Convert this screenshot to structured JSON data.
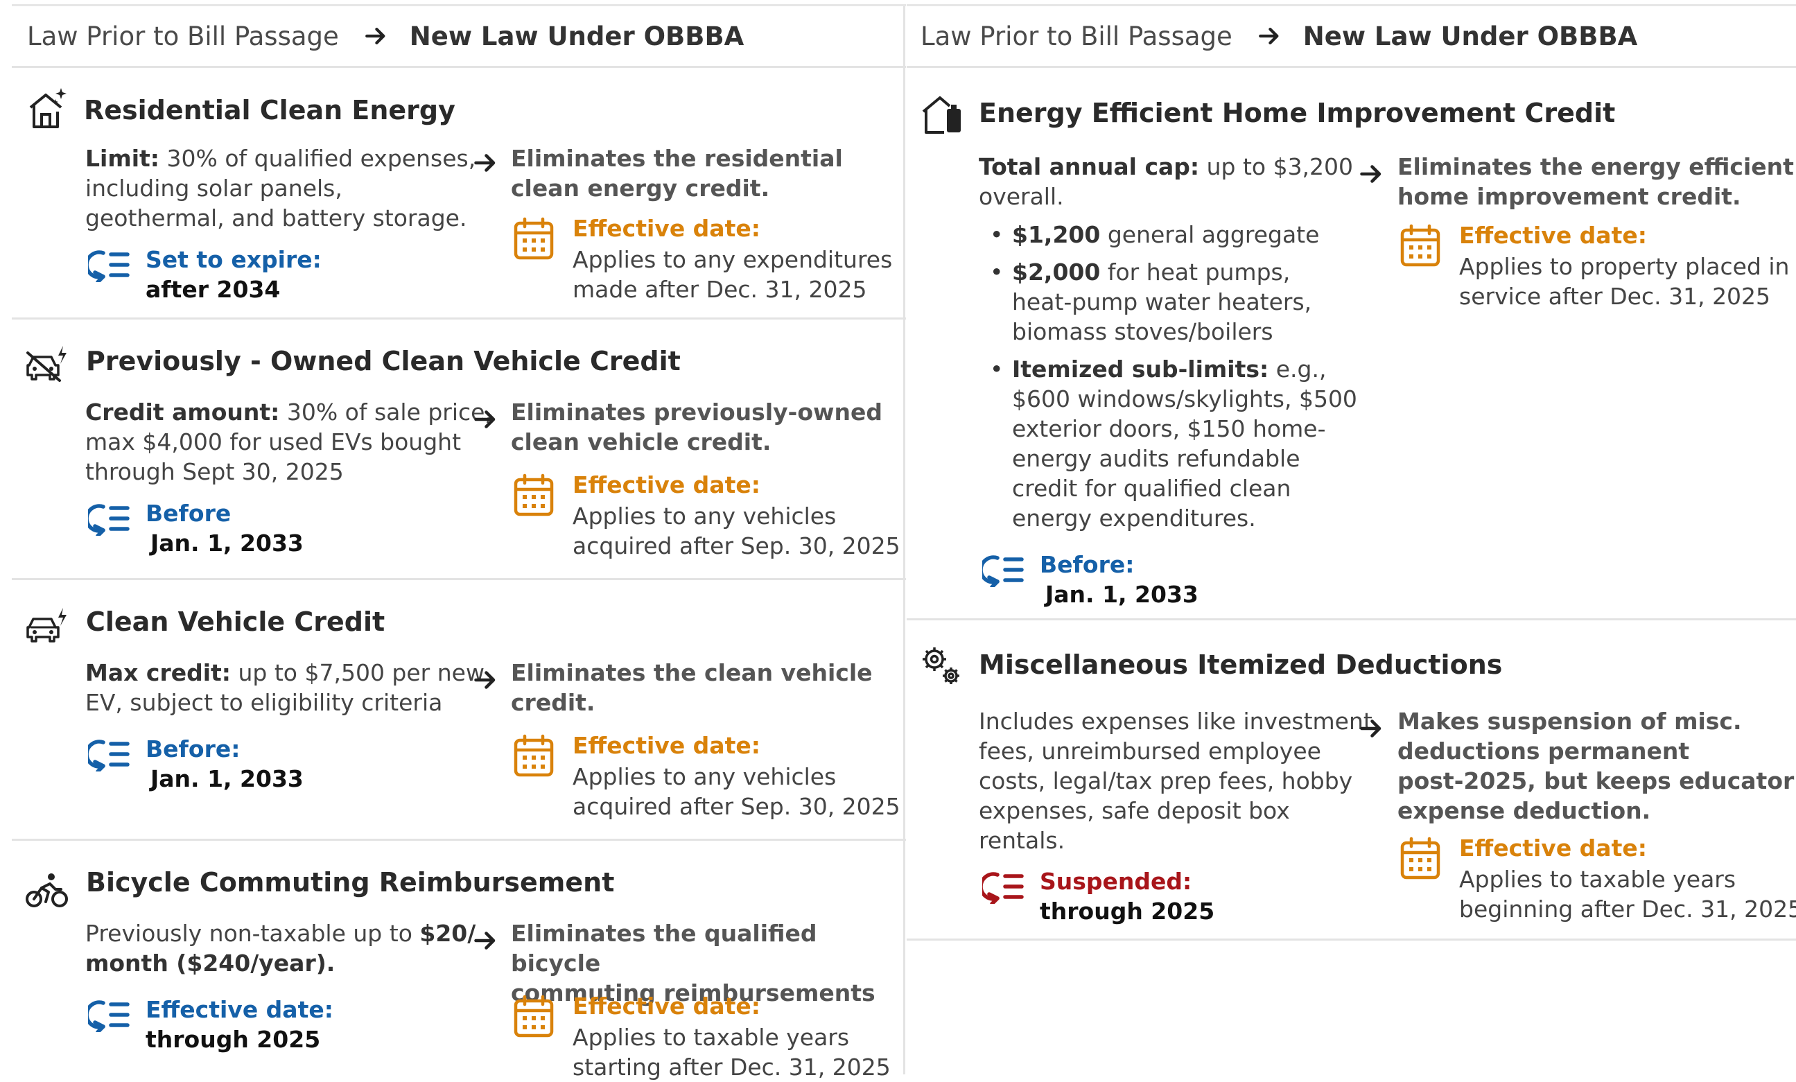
{
  "colors": {
    "blue_status": "#1560a8",
    "red_status": "#a8151a",
    "orange_effective": "#d9820a",
    "divider": "#e3e3e3"
  },
  "header": {
    "prior_label": "Law Prior to Bill Passage",
    "arrow_icon": "arrow-right-icon",
    "new_label": "New Law Under OBBBA"
  },
  "left": [
    {
      "icon": "house-sparkle-icon",
      "title": "Residential Clean Energy",
      "prior_bold": "Limit:",
      "prior_lines": [
        " 30% of qualified expenses,",
        "including solar panels,",
        "geothermal, and battery storage."
      ],
      "status_label": "Set to expire:",
      "status_value": "after 2034",
      "new_lines": [
        "Eliminates the residential",
        "clean energy credit."
      ],
      "effective_label": "Effective date:",
      "effective_lines": [
        "Applies to any expenditures",
        "made after Dec. 31, 2025"
      ]
    },
    {
      "icon": "car-slash-bolt-icon",
      "title": "Previously - Owned Clean Vehicle Credit",
      "prior_bold": "Credit amount:",
      "prior_lines": [
        " 30% of sale price,",
        "max $4,000 for used EVs bought",
        "through Sept 30, 2025"
      ],
      "status_label": "Before",
      "status_value": "Jan. 1, 2033",
      "new_lines": [
        "Eliminates previously-owned",
        "clean vehicle credit."
      ],
      "effective_label": "Effective date:",
      "effective_lines": [
        "Applies to any vehicles",
        "acquired after Sep. 30, 2025"
      ]
    },
    {
      "icon": "car-bolt-icon",
      "title": "Clean Vehicle Credit",
      "prior_bold": "Max credit:",
      "prior_lines": [
        " up to $7,500 per new",
        "EV, subject to eligibility criteria"
      ],
      "status_label": "Before:",
      "status_value": "Jan. 1, 2033",
      "new_lines": [
        "Eliminates the clean vehicle",
        "credit."
      ],
      "effective_label": "Effective date:",
      "effective_lines": [
        "Applies to any vehicles",
        "acquired after Sep. 30, 2025"
      ]
    },
    {
      "icon": "bicycle-icon",
      "title": "Bicycle Commuting Reimbursement",
      "prior_line1_plain": "Previously non-taxable up to ",
      "prior_line1_bold": "$20/",
      "prior_line2_bold": "month ($240/year).",
      "status_label": "Effective date:",
      "status_value": "through 2025",
      "new_lines": [
        "Eliminates the qualified bicycle",
        "commuting reimbursements"
      ],
      "effective_label": "Effective date:",
      "effective_lines": [
        "Applies to taxable years",
        "starting after Dec. 31, 2025"
      ]
    }
  ],
  "right": [
    {
      "icon": "house-battery-icon",
      "title": "Energy Efficient Home Improvement Credit",
      "prior_bold": "Total annual cap:",
      "prior_lines": [
        " up to $3,200",
        "overall."
      ],
      "bullets": [
        {
          "bold": "$1,200",
          "lines": [
            " general aggregate"
          ]
        },
        {
          "bold": "$2,000",
          "lines": [
            " for heat pumps,",
            "heat-pump water heaters,",
            "biomass stoves/boilers"
          ]
        },
        {
          "bold": "Itemized sub-limits:",
          "lines": [
            " e.g.,",
            "$600 windows/skylights, $500",
            "exterior doors, $150 home-",
            "energy audits refundable",
            "credit for qualified clean",
            "energy expenditures."
          ]
        }
      ],
      "status_label": "Before:",
      "status_value": "Jan. 1, 2033",
      "new_lines": [
        "Eliminates the energy efficient",
        "home improvement credit."
      ],
      "effective_label": "Effective date:",
      "effective_lines": [
        "Applies to property placed in",
        "service after Dec. 31, 2025"
      ]
    },
    {
      "icon": "gears-icon",
      "title": "Miscellaneous Itemized Deductions",
      "prior_lines": [
        "Includes expenses like investment",
        "fees, unreimbursed employee",
        "costs, legal/tax prep fees, hobby",
        "expenses, safe deposit box",
        "rentals."
      ],
      "status_label": "Suspended:",
      "status_value": "through 2025",
      "new_lines": [
        "Makes suspension of misc.",
        "deductions permanent",
        "post-2025, but keeps educator",
        "expense deduction."
      ],
      "effective_label": "Effective date:",
      "effective_lines": [
        "Applies to taxable years",
        "beginning after Dec. 31, 2025"
      ]
    }
  ]
}
